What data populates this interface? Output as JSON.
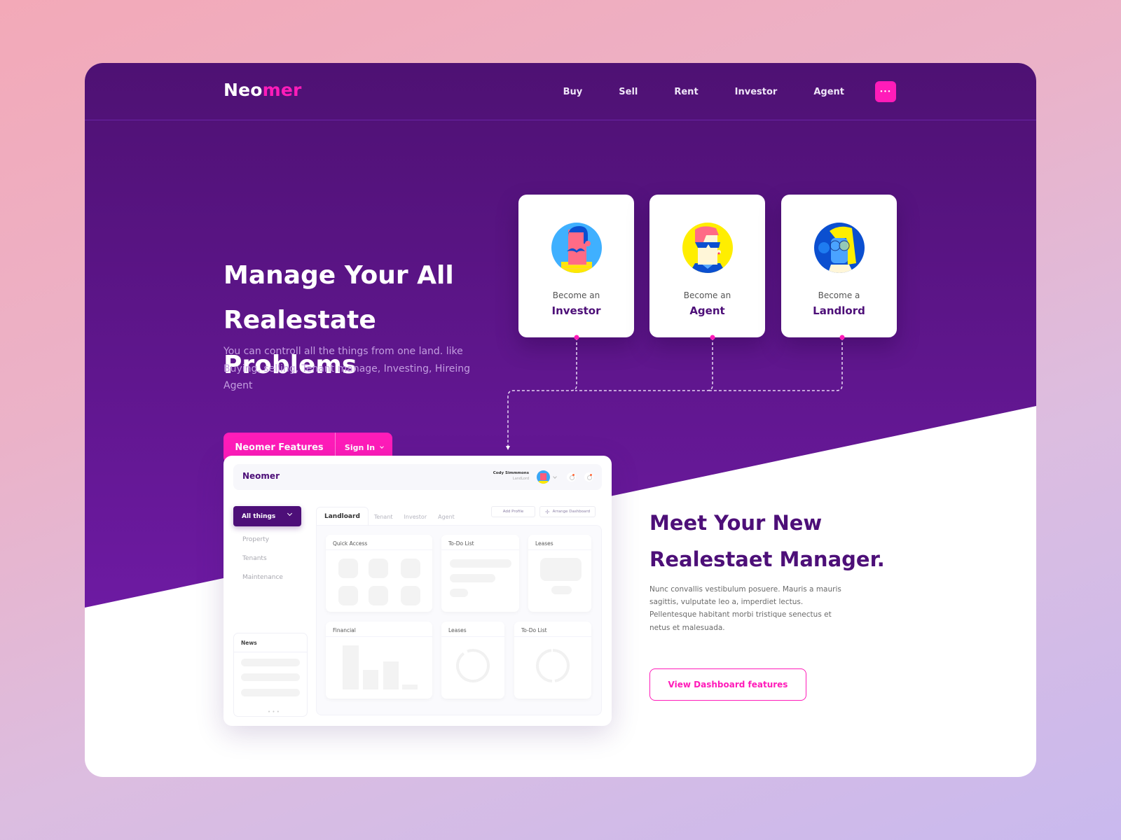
{
  "colors": {
    "brand_purple": "#4d0f78",
    "hero_purple_top": "#4e1173",
    "hero_purple_bottom": "#6a1a9e",
    "accent_pink": "#ff1cb9",
    "white": "#ffffff"
  },
  "nav": {
    "logo_part1": "Neo",
    "logo_part2": "mer",
    "links": [
      "Buy",
      "Sell",
      "Rent",
      "Investor",
      "Agent"
    ],
    "more_icon": "ellipsis-icon",
    "more_label": "•••"
  },
  "hero": {
    "title_line1": "Manage Your All",
    "title_line2": "Realestate Problems",
    "description": "You can controll all the things from one land. like Buying, selling, Tenant manage, Investing, Hireing Agent",
    "primary_button": "Neomer Features",
    "secondary_button": "Sign In"
  },
  "roles": [
    {
      "prefix": "Become an",
      "role": "Investor",
      "avatar": "investor-avatar"
    },
    {
      "prefix": "Become an",
      "role": "Agent",
      "avatar": "agent-avatar"
    },
    {
      "prefix": "Become a",
      "role": "Landlord",
      "avatar": "landlord-avatar"
    }
  ],
  "dashboard": {
    "logo": "Neomer",
    "user_name": "Cody Simmmons",
    "user_role": "LandLord",
    "filter": "All things",
    "side_items": [
      "Property",
      "Tenants",
      "Maintenance"
    ],
    "news_title": "News",
    "news_more": "• • •",
    "tabs": [
      "Landloard",
      "Tenant",
      "Investor",
      "Agent"
    ],
    "active_tab": "Landloard",
    "add_profile": "Add Profile",
    "arrange": "Arrange Dashboard",
    "cards": [
      "Quick Access",
      "To-Do List",
      "Leases",
      "Financial",
      "Leases",
      "To-Do List"
    ]
  },
  "meet": {
    "title_line1": "Meet Your New",
    "title_line2": "Realestaet Manager.",
    "description": "Nunc convallis vestibulum posuere. Mauris a mauris sagittis, vulputate leo a, imperdiet lectus. Pellentesque habitant morbi tristique senectus et netus et malesuada.",
    "button": "View Dashboard features"
  }
}
